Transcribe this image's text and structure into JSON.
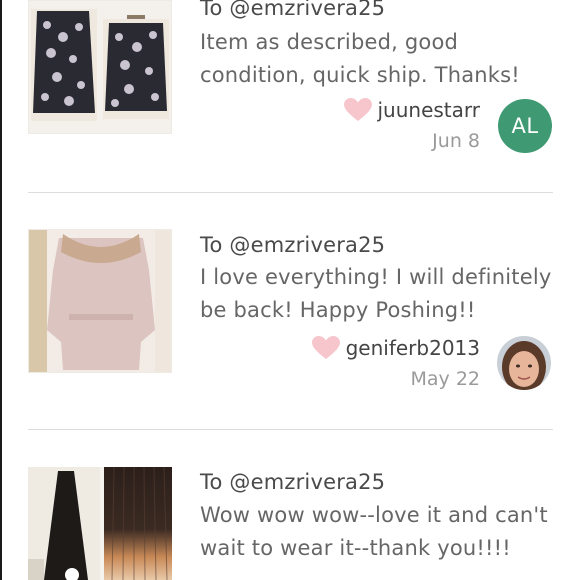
{
  "reviews": [
    {
      "to_text": "To @emzrivera25",
      "comment": "Item as described, good condition, quick ship. Thanks!",
      "username": "juunestarr",
      "date": "Jun 8",
      "avatar_initials": "AL",
      "avatar_color": "#3f9a73"
    },
    {
      "to_text": "To @emzrivera25",
      "comment": "I love everything! I will definitely be back! Happy Poshing!!",
      "username": "geniferb2013",
      "date": "May 22"
    },
    {
      "to_text": "To @emzrivera25",
      "comment": "Wow wow wow--love it and can't wait to wear it--thank you!!!!"
    }
  ],
  "colors": {
    "heart": "#f7c6cc",
    "divider": "#dddddd",
    "text_primary": "#4a4a4a",
    "text_secondary": "#666666",
    "text_muted": "#9a9a9a"
  }
}
